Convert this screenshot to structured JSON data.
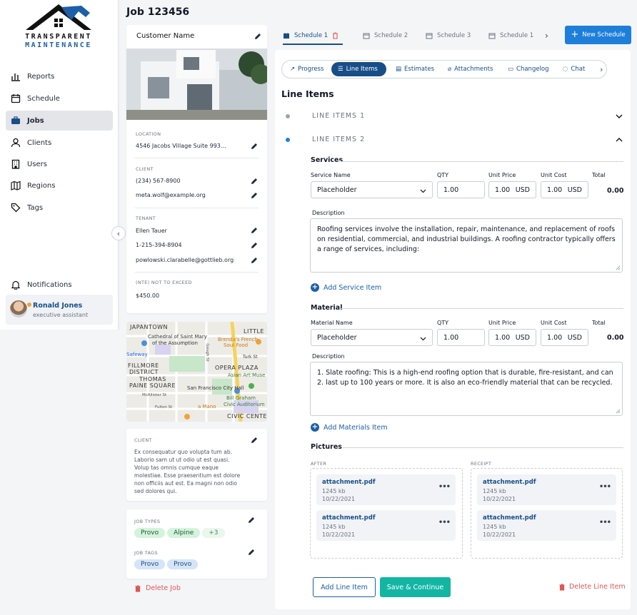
{
  "logo": {
    "line1": "TRANSPARENT",
    "line2": "MAINTENANCE",
    "color": "#1d5fa8"
  },
  "nav": [
    {
      "label": "Reports",
      "icon": "chart-bars-icon"
    },
    {
      "label": "Schedule",
      "icon": "calendar-icon"
    },
    {
      "label": "Jobs",
      "icon": "briefcase-icon",
      "active": true
    },
    {
      "label": "Clients",
      "icon": "users-icon"
    },
    {
      "label": "Users",
      "icon": "building-icon"
    },
    {
      "label": "Regions",
      "icon": "map-icon"
    },
    {
      "label": "Tags",
      "icon": "tag-icon"
    }
  ],
  "notifications": "Notifications",
  "user": {
    "name": "Ronald Jones",
    "role": "executive assistant"
  },
  "job_title": "Job 123456",
  "customer": {
    "name": "Customer Name",
    "location_label": "LOCATION",
    "location": "4546 Jacobs Village Suite 993...",
    "client_label": "CLIENT",
    "client_phone": "(234) 567-8900",
    "client_email": "meta.wolf@example.org",
    "tenant_label": "TENANT",
    "tenant_name": "Ellen Tauer",
    "tenant_phone": "1-215-394-8904",
    "tenant_email": "powlowski.clarabelle@gottlieb.org",
    "nte_label": "(NTE) NOT TO EXCEED",
    "nte": "$450.00"
  },
  "map": {
    "labels": [
      "JAPANTOWN",
      "Cathedral of Saint Mary",
      "of the Assumption",
      "LITTLE",
      "Brenda's French",
      "Soul Food",
      "Safeway",
      "Turk St",
      "FILLMORE",
      "DISTRICT",
      "OPERA PLAZA",
      "Asian Art Muse",
      "THOMAS",
      "PAINE SQUARE",
      "San Francisco City Hall",
      "Bill Graham",
      "Civic Auditorium",
      "McAllister St",
      "Fulton St",
      "a Mano",
      "CIVIC CENTE",
      "Gough St"
    ]
  },
  "client_note": {
    "label": "CLIENT",
    "text": [
      "Ex consequatur quo volupta tum ab.",
      "Laborio sam ut ut odio ut est quasi.",
      "Volup tas omnis cumque eaque",
      "molestiae. Esse praesentium est dolore",
      "non officiis aut est. Ea magni non odio",
      "sed dolores qui."
    ]
  },
  "job_types": {
    "label": "JOB TYPES",
    "items": [
      "Provo",
      "Alpine",
      "+3"
    ]
  },
  "job_tags": {
    "label": "JOB TAGS",
    "items": [
      "Provo",
      "Provo"
    ]
  },
  "delete_job": "Delete Job",
  "schedule_tabs": [
    "Schedule 1",
    "Schedule 2",
    "Schedule 3",
    "Schedule 1"
  ],
  "new_schedule": "New Schedule",
  "subtabs": [
    {
      "label": "Progress",
      "icon": "trend-icon"
    },
    {
      "label": "Line Items",
      "icon": "list-icon",
      "active": true
    },
    {
      "label": "Estimates",
      "icon": "document-icon"
    },
    {
      "label": "Attachments",
      "icon": "paperclip-icon"
    },
    {
      "label": "Changelog",
      "icon": "log-icon"
    },
    {
      "label": "Chat",
      "icon": "chat-icon"
    }
  ],
  "line_items_title": "Line Items",
  "accordions": [
    "LINE ITEMS 1",
    "LINE ITEMS 2"
  ],
  "services": {
    "title": "Services",
    "cols": {
      "name": "Service Name",
      "qty": "QTY",
      "price": "Unit Price",
      "cost": "Unit Cost",
      "total": "Total"
    },
    "name": "Placeholder",
    "qty": "1.00",
    "price": "1.00",
    "price_unit": "USD",
    "cost": "1.00",
    "cost_unit": "USD",
    "total": "0.00",
    "desc_label": "Description",
    "desc": [
      "Roofing services involve the installation, repair, maintenance, and replacement of roofs",
      "on residential, commercial, and industrial buildings. A roofing contractor typically offers",
      "a range of services, including:"
    ],
    "add": "Add Service Item"
  },
  "material": {
    "title": "Material",
    "cols": {
      "name": "Material Name",
      "qty": "QTY",
      "price": "Unit Price",
      "cost": "Unit Cost",
      "total": "Total"
    },
    "name": "Placeholder",
    "qty": "1.00",
    "price": "1.00",
    "price_unit": "USD",
    "cost": "1.00",
    "cost_unit": "USD",
    "total": "0.00",
    "desc_label": "Description",
    "desc": [
      "1. Slate roofing: This is a high-end roofing option that is durable, fire-resistant, and can",
      "2. last up to 100 years or more. It is also an eco-friendly material that can be recycled."
    ],
    "add": "Add Materials Item"
  },
  "pictures": {
    "title": "Pictures",
    "after_label": "AFTER",
    "receipt_label": "RECEIPT",
    "files": [
      {
        "name": "attachment.pdf",
        "size": "1245 kb",
        "date": "10/22/2021"
      },
      {
        "name": "attachment.pdf",
        "size": "1245 kb",
        "date": "10/22/2021"
      },
      {
        "name": "attachment.pdf",
        "size": "1245 kb",
        "date": "10/22/2021"
      },
      {
        "name": "attachment.pdf",
        "size": "1245 kb",
        "date": "10/22/2021"
      }
    ]
  },
  "actions": {
    "add": "Add Line Item",
    "save": "Save & Continue",
    "delete": "Delete Line Item"
  },
  "colors": {
    "primary": "#174e88",
    "teal": "#13b5a3",
    "danger": "#e05656"
  }
}
